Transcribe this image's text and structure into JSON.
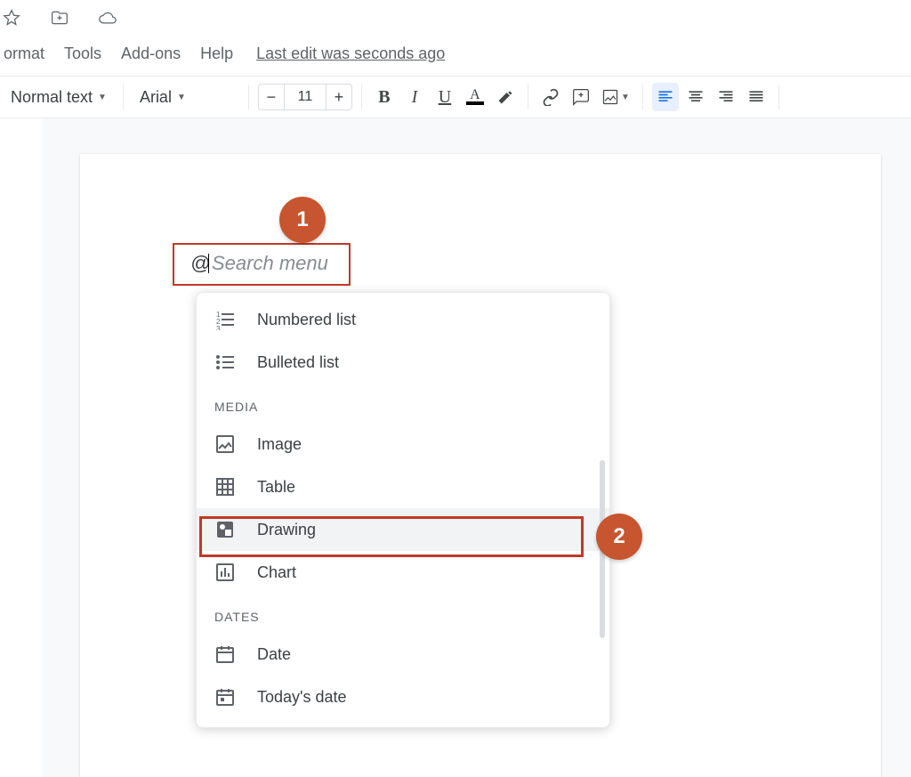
{
  "menubar": {
    "format": "ormat",
    "tools": "Tools",
    "addons": "Add-ons",
    "help": "Help",
    "last_edit": "Last edit was seconds ago"
  },
  "toolbar": {
    "style": "Normal text",
    "font": "Arial",
    "size": "11",
    "text_indicator": "A"
  },
  "search": {
    "prefix": "@",
    "placeholder": "Search menu"
  },
  "dropdown": {
    "items_top": [
      {
        "label": "Numbered list"
      },
      {
        "label": "Bulleted list"
      }
    ],
    "media_header": "MEDIA",
    "media_items": [
      {
        "label": "Image"
      },
      {
        "label": "Table"
      },
      {
        "label": "Drawing"
      },
      {
        "label": "Chart"
      }
    ],
    "dates_header": "DATES",
    "dates_items": [
      {
        "label": "Date"
      },
      {
        "label": "Today's date"
      }
    ]
  },
  "annotations": {
    "one": "1",
    "two": "2"
  }
}
